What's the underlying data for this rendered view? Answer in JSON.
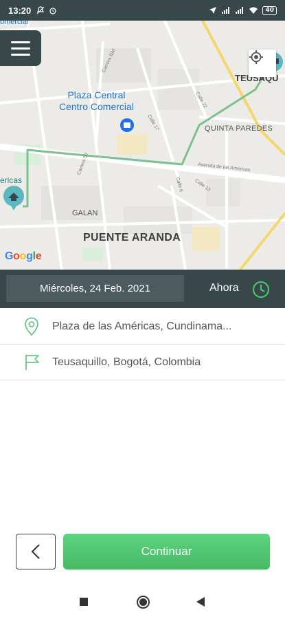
{
  "status_bar": {
    "time": "13:20",
    "battery": "40"
  },
  "map": {
    "labels": {
      "plaza_central": "Plaza Central\nCentro Comercial",
      "teusaquillo": "TEUSAQU",
      "quinta_paredes": "QUINTA PAREDES",
      "americas": "ericas",
      "galan": "GALAN",
      "puente_aranda": "PUENTE ARANDA",
      "top_partial": "omercial"
    },
    "streets": {
      "carrera_68d": "Carrera 68d",
      "calle_22": "Calle 22",
      "calle_17": "Calle 17",
      "carrera_50": "Carrera 50",
      "av_americas": "Avenida de las Americas",
      "calle_6": "Calle 6",
      "calle_13": "Calle 13"
    },
    "google": [
      "G",
      "o",
      "o",
      "g",
      "l",
      "e"
    ]
  },
  "trip": {
    "date": "Miércoles, 24 Feb. 2021",
    "time_label": "Ahora",
    "origin": "Plaza de las Américas, Cundinama...",
    "destination": "Teusaquillo, Bogotá, Colombia"
  },
  "actions": {
    "continue_label": "Continuar"
  },
  "colors": {
    "header": "#37474a",
    "accent": "#4cc26b",
    "route": "#7dc08f"
  },
  "icons": {
    "menu": "hamburger-icon",
    "locate": "crosshair-icon",
    "clock": "clock-icon",
    "origin": "location-pin-icon",
    "destination": "flag-icon",
    "back": "chevron-left-icon"
  }
}
